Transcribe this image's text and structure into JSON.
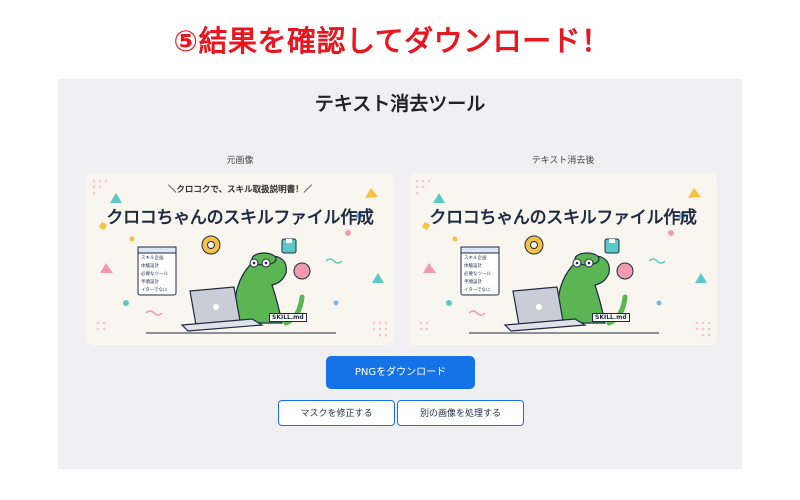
{
  "heading": "⑤結果を確認してダウンロード！",
  "tool": {
    "title": "テキスト消去ツール"
  },
  "images": {
    "original_label": "元画像",
    "result_label": "テキスト消去後",
    "banner_subtitle": "＼クロコクで、スキル取扱説明書！／",
    "banner_title": "クロコちゃんのスキルファイル作成",
    "file_tag": "SKILL.md",
    "menu_items": [
      "スキル企画",
      "体験設計",
      "必要なツール",
      "手順設計",
      "イターでなに"
    ]
  },
  "buttons": {
    "download": "PNGをダウンロード",
    "edit_mask": "マスクを修正する",
    "process_other": "別の画像を処理する"
  },
  "colors": {
    "heading": "#e8161f",
    "primary": "#1473e6",
    "panel": "#f0f0f2"
  }
}
